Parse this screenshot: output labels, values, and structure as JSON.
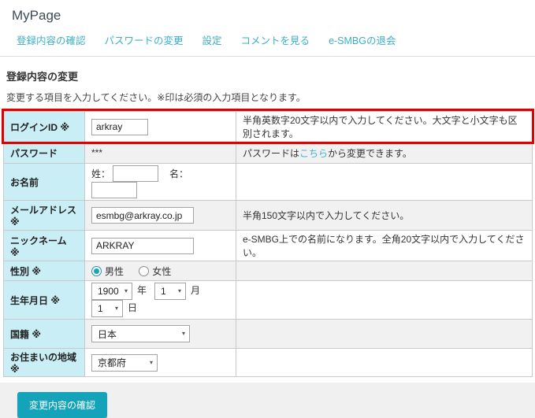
{
  "header": {
    "title": "MyPage"
  },
  "nav": {
    "items": [
      {
        "label": "登録内容の確認"
      },
      {
        "label": "パスワードの変更"
      },
      {
        "label": "設定"
      },
      {
        "label": "コメントを見る"
      },
      {
        "label": "e-SMBGの退会"
      }
    ]
  },
  "section": {
    "heading": "登録内容の変更",
    "instruction": "変更する項目を入力してください。※印は必須の入力項目となります。"
  },
  "form": {
    "rows": [
      {
        "label": "ログインID ※",
        "value": "arkray",
        "hint": "半角英数字20文字以内で入力してください。大文字と小文字も区別されます。"
      },
      {
        "label": "パスワード",
        "value": "***",
        "hint_prefix": "パスワードは",
        "hint_link": "こちら",
        "hint_suffix": "から変更できます。"
      },
      {
        "label": "お名前",
        "last_name_label": "姓：",
        "last_name_value": "",
        "first_name_label": "名：",
        "first_name_value": ""
      },
      {
        "label": "メールアドレス ※",
        "value": "esmbg@arkray.co.jp",
        "hint": "半角150文字以内で入力してください。"
      },
      {
        "label": "ニックネーム ※",
        "value": "ARKRAY",
        "hint": "e-SMBG上での名前になります。全角20文字以内で入力してください。"
      },
      {
        "label": "性別 ※",
        "options": [
          {
            "label": "男性",
            "selected": true
          },
          {
            "label": "女性",
            "selected": false
          }
        ]
      },
      {
        "label": "生年月日 ※",
        "year": "1900",
        "year_unit": "年",
        "month": "1",
        "month_unit": "月",
        "day": "1",
        "day_unit": "日"
      },
      {
        "label": "国籍 ※",
        "value": "日本"
      },
      {
        "label": "お住まいの地域 ※",
        "value": "京都府"
      }
    ]
  },
  "actions": {
    "submit_label": "変更内容の確認"
  },
  "icons": {
    "dropdown_caret": "▾"
  },
  "colors": {
    "accent": "#3bafc6",
    "button": "#14a3b9",
    "label_cell_bg": "#c9eef6",
    "highlight_red": "#e00000",
    "alt_row_bg": "#f1f1f1",
    "footer_bg": "#f0f0f0"
  }
}
